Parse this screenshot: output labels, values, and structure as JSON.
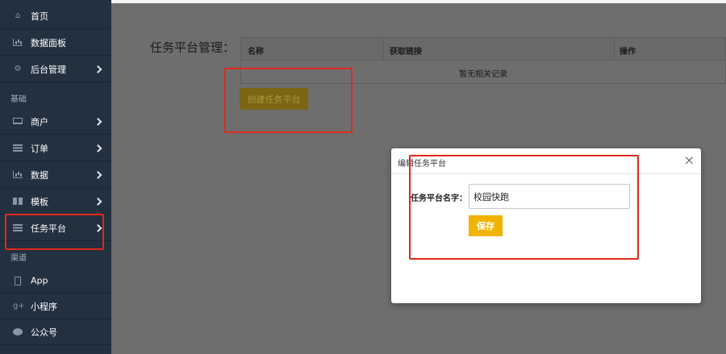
{
  "sidebar": {
    "items": [
      {
        "label": "首页",
        "icon": "home-icon"
      },
      {
        "label": "数据面板",
        "icon": "bar-chart-icon"
      },
      {
        "label": "后台管理",
        "icon": "gears-icon"
      },
      {
        "label": "商户",
        "icon": "laptop-icon"
      },
      {
        "label": "订单",
        "icon": "list-icon"
      },
      {
        "label": "数据",
        "icon": "bar-chart-icon"
      },
      {
        "label": "模板",
        "icon": "grid-icon"
      },
      {
        "label": "任务平台",
        "icon": "list-icon"
      },
      {
        "label": "App",
        "icon": "phone-icon"
      },
      {
        "label": "小程序",
        "icon": "google-plus-icon"
      },
      {
        "label": "公众号",
        "icon": "chat-icon"
      }
    ],
    "sections": {
      "basic": "基础",
      "channel": "渠道"
    }
  },
  "main": {
    "title": "任务平台管理：",
    "table": {
      "headers": [
        "名称",
        "获取链接",
        "操作"
      ],
      "empty_text": "暂无相关记录"
    },
    "create_button": "创建任务平台"
  },
  "modal": {
    "title": "编辑任务平台",
    "close": "×",
    "field_label": "任务平台名字：",
    "field_value": "校园快跑",
    "save_button": "保存"
  },
  "colors": {
    "sidebar_bg": "#233040",
    "annotation_red": "#e0281c",
    "save_button": "#f0b400"
  }
}
